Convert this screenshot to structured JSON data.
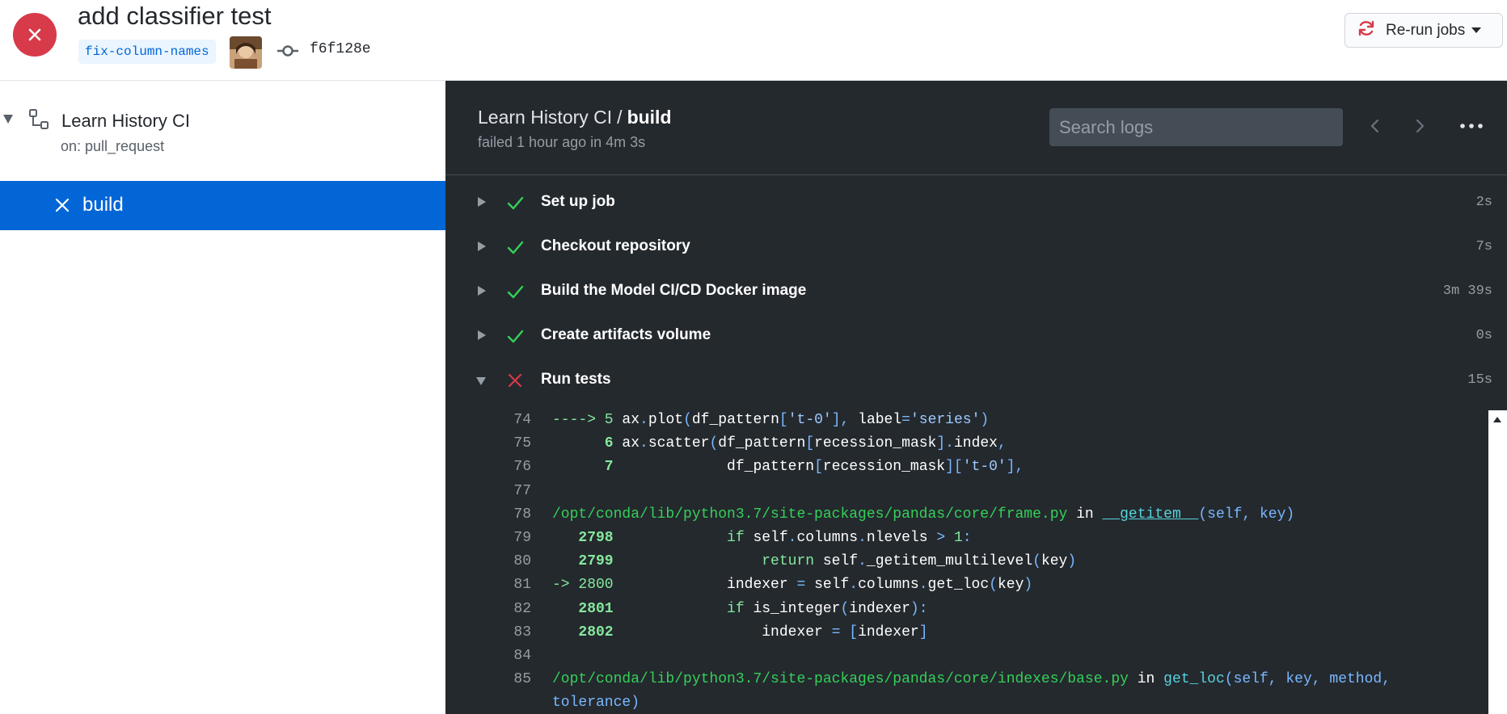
{
  "run": {
    "title": "add classifier test",
    "branch": "fix-column-names",
    "commit_sha": "f6f128e",
    "rerun_label": "Re-run jobs",
    "status": "failed"
  },
  "sidebar": {
    "workflow_name": "Learn History CI",
    "trigger": "on: pull_request",
    "jobs": [
      {
        "name": "build",
        "status": "failed",
        "selected": true
      }
    ]
  },
  "panel": {
    "workflow_crumb": "Learn History CI",
    "separator": "/",
    "job_name": "build",
    "meta": "failed 1 hour ago in 4m 3s",
    "search_placeholder": "Search logs"
  },
  "steps": [
    {
      "name": "Set up job",
      "duration": "2s",
      "status": "success",
      "expanded": false
    },
    {
      "name": "Checkout repository",
      "duration": "7s",
      "status": "success",
      "expanded": false
    },
    {
      "name": "Build the Model CI/CD Docker image",
      "duration": "3m 39s",
      "status": "success",
      "expanded": false
    },
    {
      "name": "Create artifacts volume",
      "duration": "0s",
      "status": "success",
      "expanded": false
    },
    {
      "name": "Run tests",
      "duration": "15s",
      "status": "failed",
      "expanded": true
    }
  ],
  "log_lines": [
    {
      "n": "74",
      "segments": [
        [
          "c-green",
          "----> 5 "
        ],
        [
          "c-white",
          "ax"
        ],
        [
          "c-blue",
          "."
        ],
        [
          "c-white",
          "plot"
        ],
        [
          "c-blue",
          "("
        ],
        [
          "c-white",
          "df_pattern"
        ],
        [
          "c-blue",
          "["
        ],
        [
          "c-str",
          "'t-0'"
        ],
        [
          "c-blue",
          "], "
        ],
        [
          "c-white",
          "label"
        ],
        [
          "c-blue",
          "="
        ],
        [
          "c-str",
          "'series'"
        ],
        [
          "c-blue",
          ")"
        ]
      ]
    },
    {
      "n": "75",
      "segments": [
        [
          "c-greenb",
          "      6 "
        ],
        [
          "c-white",
          "ax"
        ],
        [
          "c-blue",
          "."
        ],
        [
          "c-white",
          "scatter"
        ],
        [
          "c-blue",
          "("
        ],
        [
          "c-white",
          "df_pattern"
        ],
        [
          "c-blue",
          "["
        ],
        [
          "c-white",
          "recession_mask"
        ],
        [
          "c-blue",
          "]."
        ],
        [
          "c-white",
          "index"
        ],
        [
          "c-blue",
          ","
        ]
      ]
    },
    {
      "n": "76",
      "segments": [
        [
          "c-greenb",
          "      7 "
        ],
        [
          "c-white",
          "            df_pattern"
        ],
        [
          "c-blue",
          "["
        ],
        [
          "c-white",
          "recession_mask"
        ],
        [
          "c-blue",
          "]["
        ],
        [
          "c-str",
          "'t-0'"
        ],
        [
          "c-blue",
          "],"
        ]
      ]
    },
    {
      "n": "77",
      "segments": []
    },
    {
      "n": "78",
      "segments": [
        [
          "c-path",
          "/opt/conda/lib/python3.7/site-packages/pandas/core/frame.py"
        ],
        [
          "c-white",
          " in "
        ],
        [
          "c-fn",
          "__getitem__"
        ],
        [
          "c-blue",
          "(self, key)"
        ]
      ]
    },
    {
      "n": "79",
      "segments": [
        [
          "c-greenb",
          "   2798 "
        ],
        [
          "c-white",
          "            "
        ],
        [
          "c-green",
          "if"
        ],
        [
          "c-white",
          " self"
        ],
        [
          "c-blue",
          "."
        ],
        [
          "c-white",
          "columns"
        ],
        [
          "c-blue",
          "."
        ],
        [
          "c-white",
          "nlevels "
        ],
        [
          "c-blue",
          "> "
        ],
        [
          "c-green",
          "1"
        ],
        [
          "c-blue",
          ":"
        ]
      ]
    },
    {
      "n": "80",
      "segments": [
        [
          "c-greenb",
          "   2799 "
        ],
        [
          "c-white",
          "                "
        ],
        [
          "c-green",
          "return"
        ],
        [
          "c-white",
          " self"
        ],
        [
          "c-blue",
          "."
        ],
        [
          "c-white",
          "_getitem_multilevel"
        ],
        [
          "c-blue",
          "("
        ],
        [
          "c-white",
          "key"
        ],
        [
          "c-blue",
          ")"
        ]
      ]
    },
    {
      "n": "81",
      "segments": [
        [
          "c-green",
          "-> 2800 "
        ],
        [
          "c-white",
          "            indexer "
        ],
        [
          "c-blue",
          "= "
        ],
        [
          "c-white",
          "self"
        ],
        [
          "c-blue",
          "."
        ],
        [
          "c-white",
          "columns"
        ],
        [
          "c-blue",
          "."
        ],
        [
          "c-white",
          "get_loc"
        ],
        [
          "c-blue",
          "("
        ],
        [
          "c-white",
          "key"
        ],
        [
          "c-blue",
          ")"
        ]
      ]
    },
    {
      "n": "82",
      "segments": [
        [
          "c-greenb",
          "   2801 "
        ],
        [
          "c-white",
          "            "
        ],
        [
          "c-green",
          "if"
        ],
        [
          "c-white",
          " is_integer"
        ],
        [
          "c-blue",
          "("
        ],
        [
          "c-white",
          "indexer"
        ],
        [
          "c-blue",
          "):"
        ]
      ]
    },
    {
      "n": "83",
      "segments": [
        [
          "c-greenb",
          "   2802 "
        ],
        [
          "c-white",
          "                indexer "
        ],
        [
          "c-blue",
          "= ["
        ],
        [
          "c-white",
          "indexer"
        ],
        [
          "c-blue",
          "]"
        ]
      ]
    },
    {
      "n": "84",
      "segments": []
    },
    {
      "n": "85",
      "segments": [
        [
          "c-path",
          "/opt/conda/lib/python3.7/site-packages/pandas/core/indexes/base.py"
        ],
        [
          "c-white",
          " in "
        ],
        [
          "c-cyan",
          "get_loc"
        ],
        [
          "c-blue",
          "(self, key, method,"
        ]
      ]
    },
    {
      "n": "",
      "segments": [
        [
          "c-blue",
          "tolerance)"
        ]
      ]
    }
  ],
  "colors": {
    "failure": "#d73a49",
    "success": "#34d058",
    "accent": "#0366d6",
    "log_bg": "#24292e"
  },
  "icons": {
    "status": "x-circle-icon",
    "workflow": "workflow-icon",
    "commit": "git-commit-icon",
    "rerun": "sync-icon",
    "more": "kebab-horizontal-icon"
  }
}
